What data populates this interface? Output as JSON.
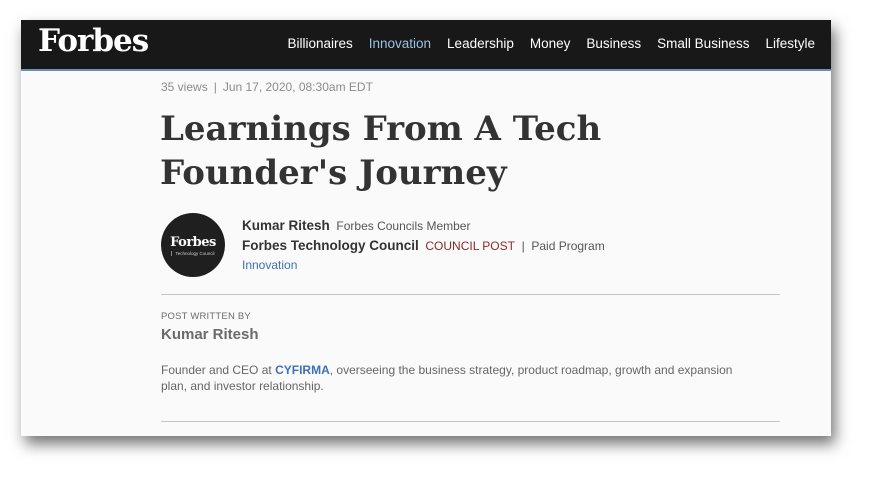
{
  "nav": {
    "logo": "Forbes",
    "items": [
      {
        "label": "Billionaires",
        "active": false
      },
      {
        "label": "Innovation",
        "active": true
      },
      {
        "label": "Leadership",
        "active": false
      },
      {
        "label": "Money",
        "active": false
      },
      {
        "label": "Business",
        "active": false
      },
      {
        "label": "Small Business",
        "active": false
      },
      {
        "label": "Lifestyle",
        "active": false
      }
    ],
    "active_color": "#9cc0e3"
  },
  "article": {
    "views": "35 views",
    "separator": "|",
    "date": "Jun 17, 2020, 08:30am EDT",
    "title": "Learnings From A Tech Founder's Journey"
  },
  "author": {
    "avatar_title": "Forbes",
    "avatar_subtitle": "Technology Council",
    "name": "Kumar Ritesh",
    "role": "Forbes Councils Member",
    "council": "Forbes Technology Council",
    "post_type": "COUNCIL POST",
    "paid_separator": "|",
    "paid_label": "Paid Program",
    "category": "Innovation"
  },
  "about": {
    "label": "POST WRITTEN BY",
    "name": "Kumar Ritesh",
    "bio_prefix": "Founder and CEO at ",
    "company": "CYFIRMA",
    "bio_suffix": ", overseeing the business strategy, product roadmap, growth and expansion plan, and investor relationship."
  }
}
